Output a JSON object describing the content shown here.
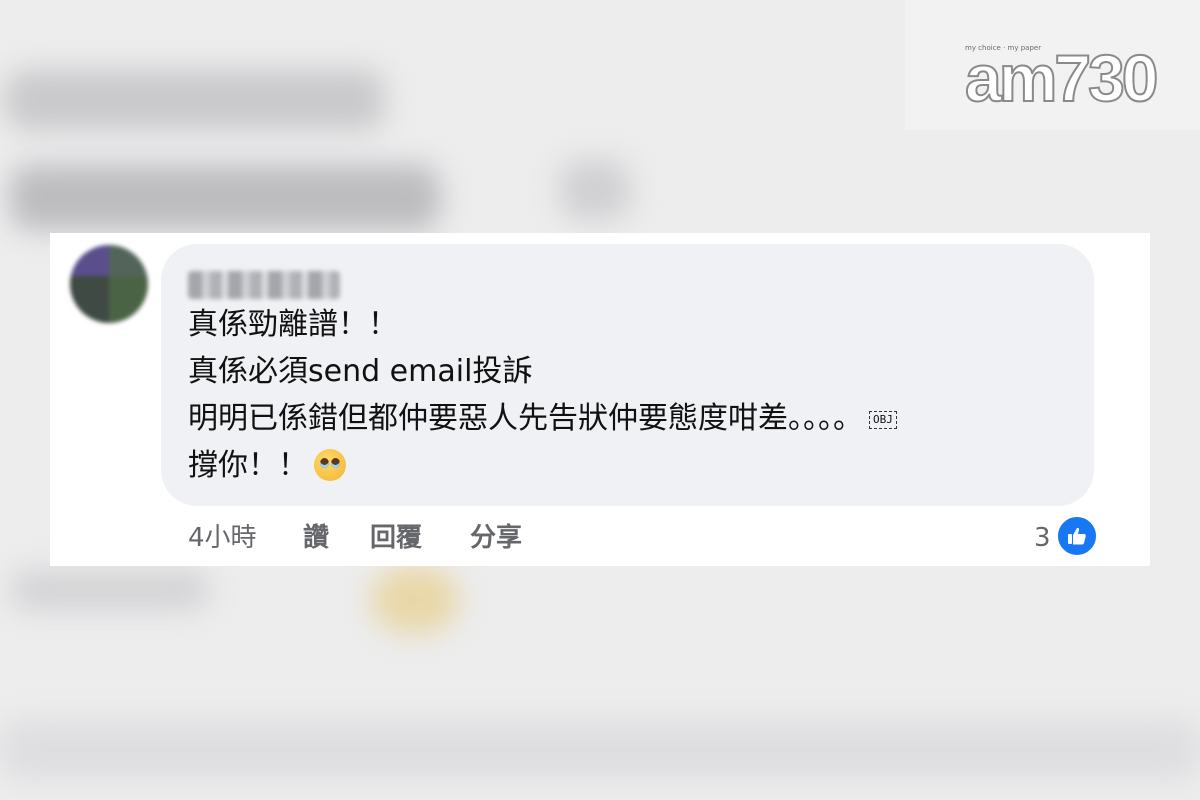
{
  "logo": {
    "tagline": "my choice · my paper",
    "text": "am730"
  },
  "comment": {
    "lines": [
      "真係勁離譜！！",
      "真係必須send email投訴",
      "明明已係錯但都仲要惡人先告狀仲要態度咁差。。。。",
      "撐你！！"
    ],
    "obj_placeholder": "OBJ",
    "emoji": "pleading-face-icon"
  },
  "actions": {
    "time": "4小時",
    "like": "讚",
    "reply": "回覆",
    "share": "分享"
  },
  "reactions": {
    "count": "3",
    "icon": "thumbs-up-icon",
    "color": "#1877f2"
  }
}
